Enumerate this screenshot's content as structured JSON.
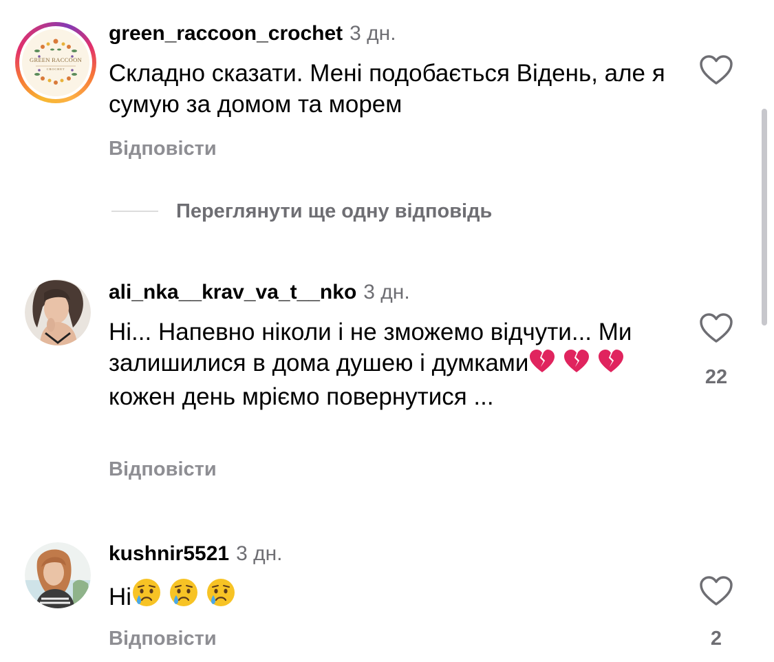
{
  "comments": [
    {
      "username": "green_raccoon_crochet",
      "time": "3 дн.",
      "text": "Складно сказати. Мені подобається Відень, але я сумую за домом та морем",
      "reply_label": "Відповісти",
      "likes": "",
      "avatar_logo_text": "GREEN RACCOON",
      "avatar_logo_subtext": "CROCHET"
    },
    {
      "username": "ali_nka__krav_va_t__nko",
      "time": "3 дн.",
      "text_part1": "Ні... Напевно ніколи і не зможемо відчути... Ми залишилися в дома душею і думками",
      "text_part2": " кожен день мріємо повернутися ...",
      "reply_label": "Відповісти",
      "likes": "22"
    },
    {
      "username": "kushnir5521",
      "time": "3 дн.",
      "text": "Ні",
      "reply_label": "Відповісти",
      "likes": "2"
    }
  ],
  "view_more_replies": "Переглянути ще одну відповідь",
  "icons": {
    "heart": "heart-outline-icon",
    "broken_heart": "broken-heart-emoji",
    "crying_face": "crying-face-emoji"
  },
  "colors": {
    "secondary_text": "#6e6e73",
    "reply_text": "#8e8e93",
    "broken_heart": "#e0245e",
    "emoji_face": "#f7c325"
  }
}
